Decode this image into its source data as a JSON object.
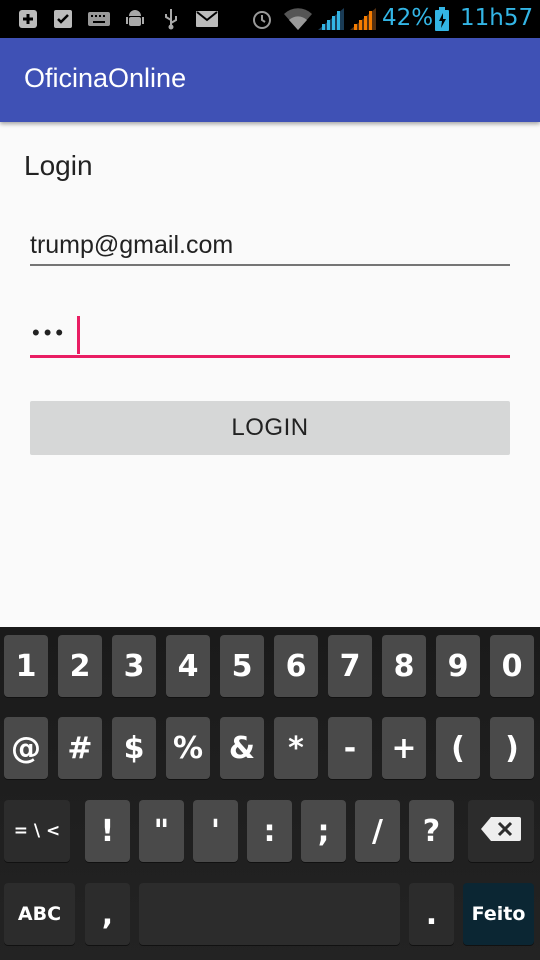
{
  "status_bar": {
    "icons_left": [
      "add-box-icon",
      "check-box-icon",
      "keyboard-icon",
      "android-debug-icon",
      "usb-icon",
      "mail-icon"
    ],
    "icons_right": [
      "alarm-icon",
      "wifi-icon",
      "signal-icon",
      "signal-alt-icon"
    ],
    "battery": "42%",
    "time": "11h57"
  },
  "app_bar": {
    "title": "OficinaOnline"
  },
  "form": {
    "heading": "Login",
    "email_value": "trump@gmail.com",
    "password_dots": "•••",
    "login_label": "LOGIN"
  },
  "keyboard": {
    "row1": [
      "1",
      "2",
      "3",
      "4",
      "5",
      "6",
      "7",
      "8",
      "9",
      "0"
    ],
    "row2": [
      "@",
      "#",
      "$",
      "%",
      "&",
      "*",
      "-",
      "+",
      "(",
      ")"
    ],
    "row3_special": "= \\ <",
    "row3": [
      "!",
      "\"",
      "'",
      ":",
      ";",
      "/",
      "?"
    ],
    "abc_label": "ABC",
    "comma_label": ",",
    "period_label": ".",
    "done_label": "Feito"
  },
  "colors": {
    "app_bar": "#3f51b5",
    "accent": "#e91e63",
    "status_text": "#33b5e5"
  }
}
